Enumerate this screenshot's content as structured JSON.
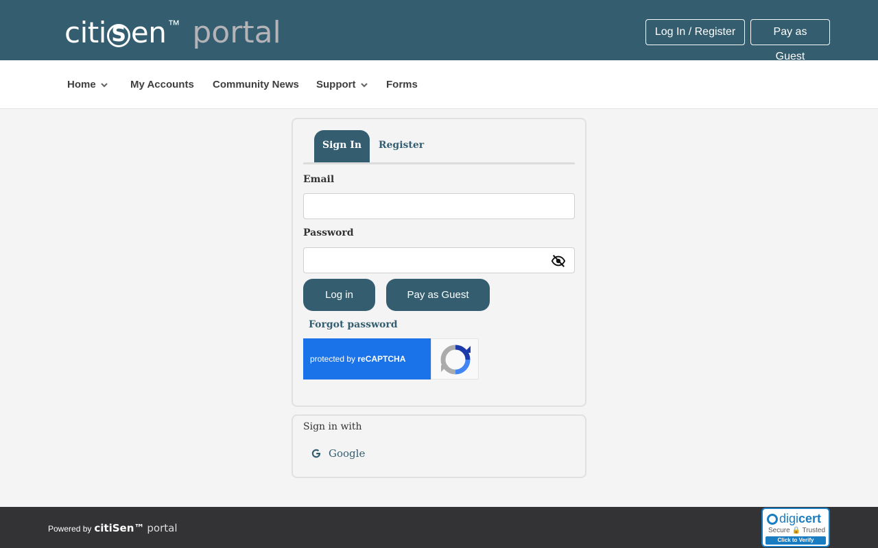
{
  "header": {
    "brand": {
      "part1": "citi",
      "s": "S",
      "part2": "en",
      "tm": "™",
      "portal": "portal"
    },
    "login_register": "Log In / Register",
    "pay_as_guest": "Pay as Guest"
  },
  "nav": {
    "items": [
      {
        "label": "Home",
        "has_dropdown": true
      },
      {
        "label": "My Accounts",
        "has_dropdown": false
      },
      {
        "label": "Community News",
        "has_dropdown": false
      },
      {
        "label": "Support",
        "has_dropdown": true
      },
      {
        "label": "Forms",
        "has_dropdown": false
      }
    ]
  },
  "signin": {
    "tabs": [
      {
        "label": "Sign In",
        "active": true
      },
      {
        "label": "Register",
        "active": false
      }
    ],
    "email_label": "Email",
    "email_value": "",
    "password_label": "Password",
    "password_value": "",
    "login_button": "Log in",
    "guest_button": "Pay as Guest",
    "forgot_password": "Forgot password",
    "recaptcha": {
      "prefix": "protected by ",
      "name": "reCAPTCHA"
    }
  },
  "signin_with": {
    "title": "Sign in with",
    "providers": [
      {
        "label": "Google",
        "icon": "google-icon"
      }
    ]
  },
  "footer": {
    "powered_by": "Powered by",
    "brand": "citiSen™",
    "portal": "portal",
    "digicert": {
      "name_a": "digi",
      "name_b": "cert",
      "secure": "Secure 🔒 Trusted",
      "verify": "Click to Verify"
    }
  },
  "colors": {
    "primary": "#345e70",
    "background": "#f4f4f4",
    "footer": "#333336",
    "recaptcha_blue": "#1a73e8"
  }
}
